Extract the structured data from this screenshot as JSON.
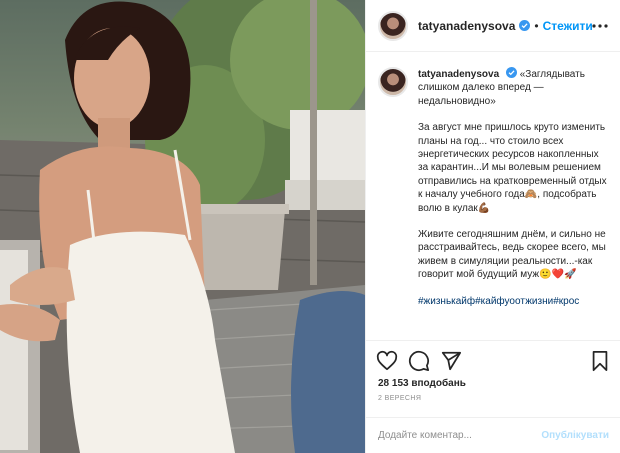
{
  "post": {
    "username": "tatyanadenysova",
    "follow_label": "Стежити",
    "separator": "•",
    "caption": {
      "username": "tatyanadenysova",
      "paragraphs": [
        "«Заглядывать слишком далеко вперед — недальновидно»",
        "За август мне пришлось круто изменить планы на год... что стоило всех энергетических ресурсов накопленных за карантин...И мы волевым решением отправились на кратковременный отдых к началу учебного года🙈, подсобрать волю в кулак💪🏾",
        "Живите сегодняшним днём, и сильно не расстраивайтесь, ведь скорее всего, мы живем в симуляции реальности...-как говорит мой будущий муж🙂❤️🚀"
      ],
      "hashtags": "#жизнькайф#кайфуоотжизни#крос"
    },
    "likes": "28 153 вподобань",
    "date": "2 вересня",
    "comment_placeholder": "Додайте коментар...",
    "publish_label": "Опублікувати"
  },
  "icons": {
    "verified": "verified-badge-icon",
    "more": "more-options-icon",
    "like": "heart-icon",
    "comment": "comment-icon",
    "share": "share-icon",
    "save": "bookmark-icon"
  },
  "colors": {
    "accent": "#0095f6",
    "verified": "#3897f0",
    "hashtag": "#00376b",
    "publish_disabled": "#b2dffc",
    "muted": "#8e8e8e",
    "border": "#efefef"
  }
}
